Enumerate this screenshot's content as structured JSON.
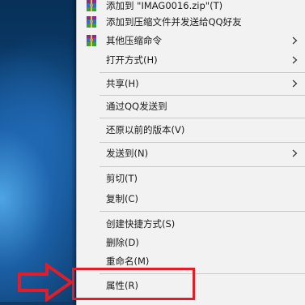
{
  "menu": {
    "items": [
      {
        "label": "添加到 \"IMAG0016.zip\"(T)",
        "icon": "winrar-archive-icon"
      },
      {
        "label": "添加到压缩文件并发送给QQ好友",
        "icon": "winrar-archive-icon"
      },
      {
        "label": "其他压缩命令",
        "icon": "winrar-archive-icon",
        "submenu": true
      },
      {
        "label": "打开方式(H)",
        "submenu": true
      },
      {
        "label": "共享(H)",
        "submenu": true
      },
      {
        "label": "通过QQ发送到"
      },
      {
        "label": "还原以前的版本(V)"
      },
      {
        "label": "发送到(N)",
        "submenu": true
      },
      {
        "label": "剪切(T)"
      },
      {
        "label": "复制(C)"
      },
      {
        "label": "创建快捷方式(S)"
      },
      {
        "label": "删除(D)"
      },
      {
        "label": "重命名(M)"
      },
      {
        "label": "属性(R)"
      }
    ]
  },
  "annotation": {
    "highlight_color": "#e11d2a",
    "pointer_icon": "right-arrow-pointer-icon",
    "target_item": "属性(R)"
  },
  "colors": {
    "menu_background": "#f2f2f2",
    "separator": "#c8c8c8",
    "desktop_accent": "#52aaeb"
  }
}
